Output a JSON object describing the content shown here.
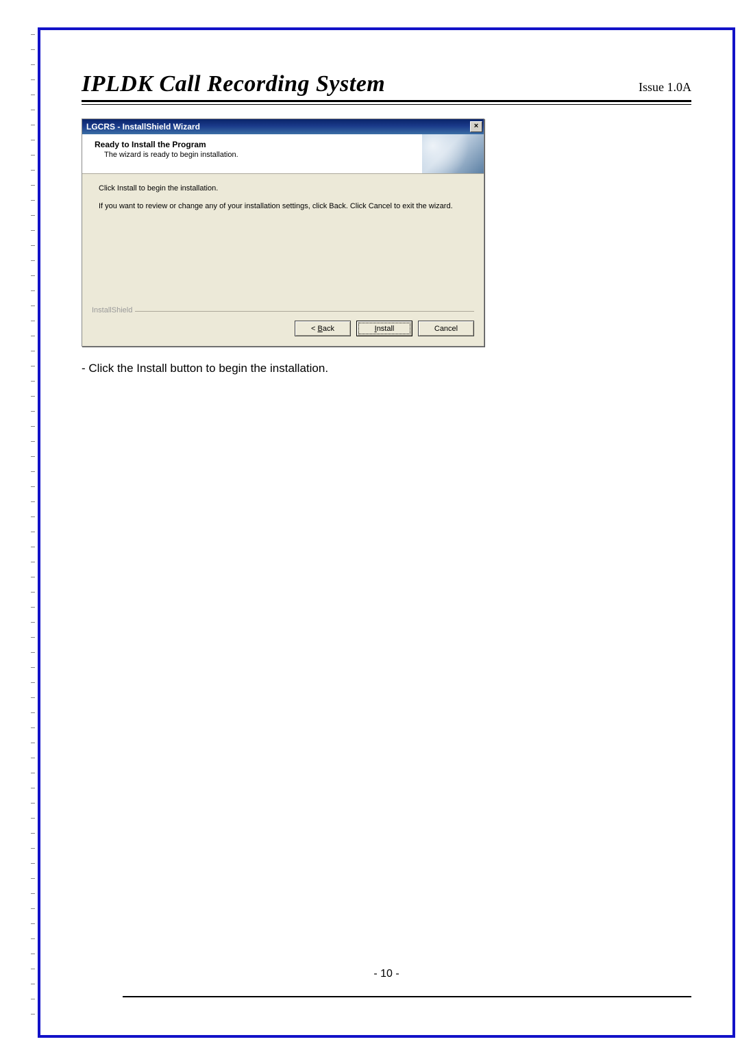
{
  "doc": {
    "title": "IPLDK Call Recording System",
    "issue": "Issue 1.0A",
    "page_number": "- 10 -"
  },
  "wizard": {
    "window_title": "LGCRS - InstallShield Wizard",
    "close_btn": "×",
    "header_title": "Ready to Install the Program",
    "header_sub": "The wizard is ready to begin installation.",
    "body_line1": "Click Install to begin the installation.",
    "body_line2": "If you want to review or change any of your installation settings, click Back. Click Cancel to exit the wizard.",
    "footer_brand": "InstallShield",
    "back_prefix": "< ",
    "back_u": "B",
    "back_rest": "ack",
    "install_u": "I",
    "install_rest": "nstall",
    "cancel_label": "Cancel"
  },
  "instruction": {
    "text": "- Click the Install button to begin the installation."
  }
}
